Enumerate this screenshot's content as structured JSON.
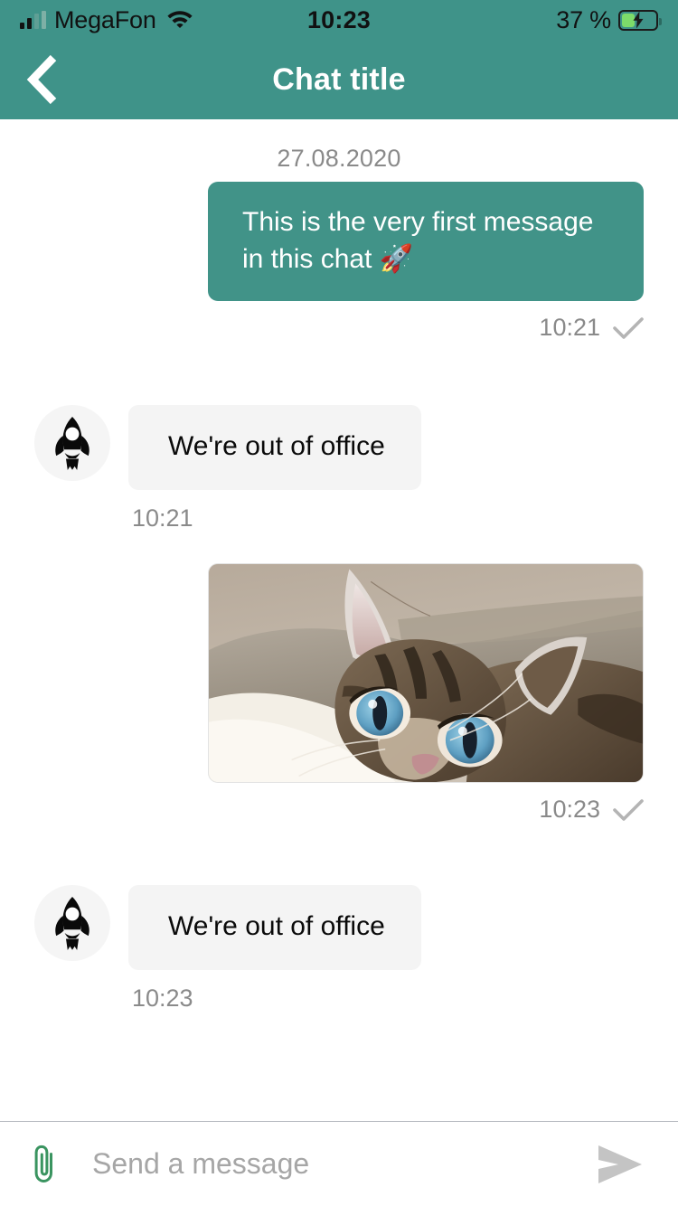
{
  "status_bar": {
    "carrier": "MegaFon",
    "time": "10:23",
    "battery_label": "37 %",
    "battery_percent": 37,
    "signal_icon": "signal-bars-icon",
    "wifi_icon": "wifi-icon",
    "battery_icon": "battery-charging-icon"
  },
  "header": {
    "title": "Chat title",
    "back_icon": "chevron-left-icon",
    "background_color": "#3f9389"
  },
  "conversation": {
    "date_separator": "27.08.2020",
    "messages": [
      {
        "direction": "outgoing",
        "type": "text",
        "text": "This is the very first message in this chat 🚀",
        "time": "10:21",
        "status_icon": "check-icon"
      },
      {
        "direction": "incoming",
        "type": "text",
        "text": "We're out of office",
        "time": "10:21",
        "avatar_icon": "rocket-avatar-icon"
      },
      {
        "direction": "outgoing",
        "type": "image",
        "image_alt": "kitten-photo",
        "time": "10:23",
        "status_icon": "check-icon"
      },
      {
        "direction": "incoming",
        "type": "text",
        "text": "We're out of office",
        "time": "10:23",
        "avatar_icon": "rocket-avatar-icon"
      }
    ]
  },
  "composer": {
    "attach_icon": "paperclip-icon",
    "placeholder": "Send a message",
    "value": "",
    "send_icon": "send-arrow-icon"
  },
  "colors": {
    "accent_teal": "#3f9389",
    "bubble_out": "#419388",
    "bubble_in": "#f4f4f4",
    "meta_gray": "#8a8a8a",
    "attach_green": "#3a9460",
    "send_gray": "#c4c4c4"
  }
}
